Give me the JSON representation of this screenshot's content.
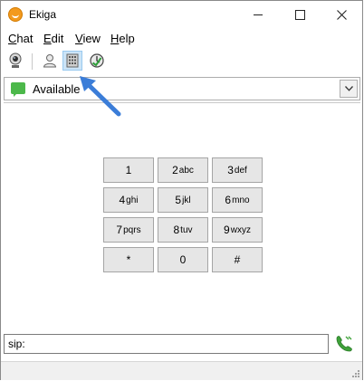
{
  "window": {
    "title": "Ekiga"
  },
  "menubar": {
    "items": [
      {
        "mnemonic": "C",
        "rest": "hat"
      },
      {
        "mnemonic": "E",
        "rest": "dit"
      },
      {
        "mnemonic": "V",
        "rest": "iew"
      },
      {
        "mnemonic": "H",
        "rest": "elp"
      }
    ]
  },
  "toolbar": {
    "icons": [
      "webcam-icon",
      "contacts-icon",
      "dialpad-icon",
      "call-history-icon"
    ],
    "active": "dialpad-icon"
  },
  "presence": {
    "status": "Available",
    "color": "#4cb84a"
  },
  "dialpad": {
    "keys": [
      {
        "digit": "1",
        "letters": ""
      },
      {
        "digit": "2",
        "letters": "abc"
      },
      {
        "digit": "3",
        "letters": "def"
      },
      {
        "digit": "4",
        "letters": "ghi"
      },
      {
        "digit": "5",
        "letters": "jkl"
      },
      {
        "digit": "6",
        "letters": "mno"
      },
      {
        "digit": "7",
        "letters": "pqrs"
      },
      {
        "digit": "8",
        "letters": "tuv"
      },
      {
        "digit": "9",
        "letters": "wxyz"
      },
      {
        "digit": "*",
        "letters": ""
      },
      {
        "digit": "0",
        "letters": ""
      },
      {
        "digit": "#",
        "letters": ""
      }
    ]
  },
  "uri_entry": {
    "value": "sip:"
  },
  "colors": {
    "accent_arrow": "#3b7dd8",
    "key_bg": "#e6e6e6"
  }
}
